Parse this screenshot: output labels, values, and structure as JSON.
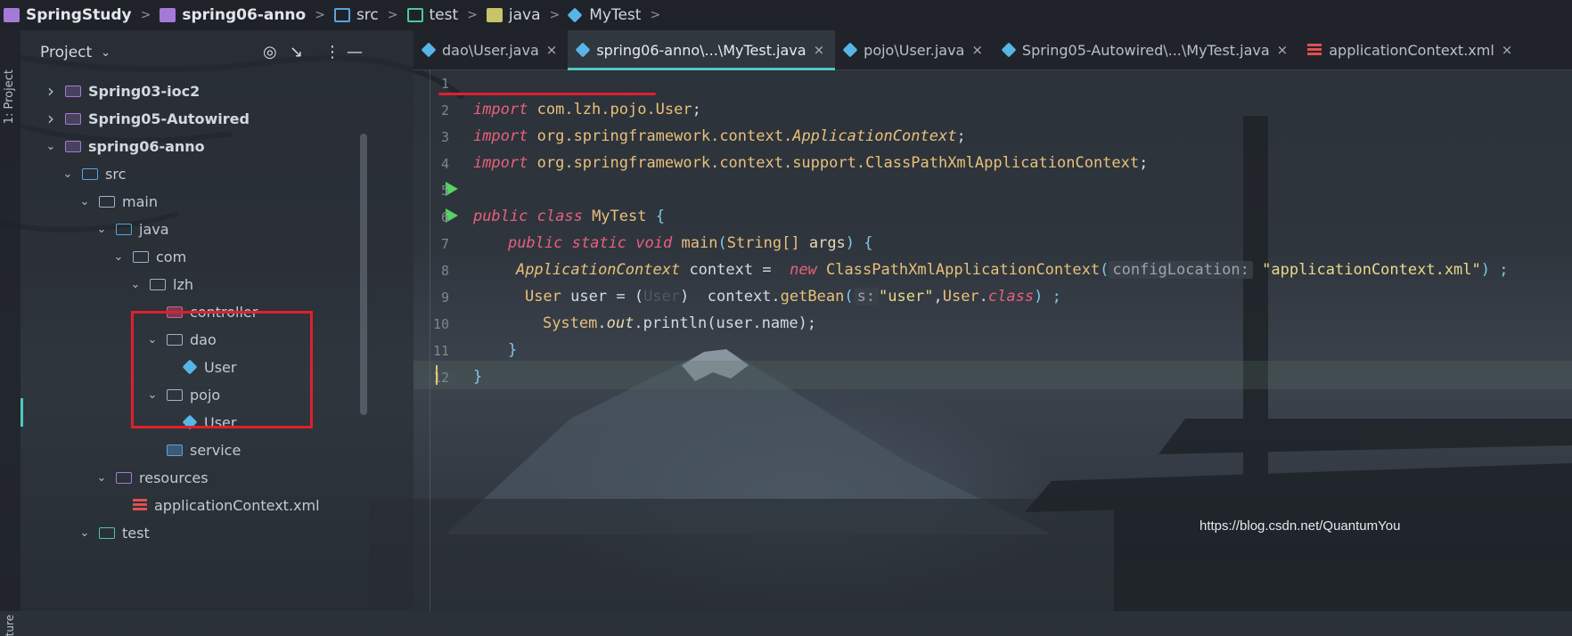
{
  "breadcrumb": [
    {
      "label": "SpringStudy",
      "icon": "project-icon",
      "bold": true
    },
    {
      "label": "spring06-anno",
      "icon": "module-icon",
      "bold": true
    },
    {
      "label": "src",
      "icon": "src-folder-icon",
      "bold": false
    },
    {
      "label": "test",
      "icon": "test-folder-icon",
      "bold": false
    },
    {
      "label": "java",
      "icon": "folder-icon",
      "bold": false
    },
    {
      "label": "MyTest",
      "icon": "class-icon",
      "bold": false
    }
  ],
  "left_strip": {
    "project_label": "1: Project",
    "structure_label": "ture"
  },
  "panel": {
    "title": "Project"
  },
  "tree": {
    "items": [
      {
        "label": "Spring03-ioc2",
        "depth": 0,
        "chev": ">",
        "kind": "mod",
        "bold": true
      },
      {
        "label": "Spring05-Autowired",
        "depth": 0,
        "chev": ">",
        "kind": "mod",
        "bold": true
      },
      {
        "label": "spring06-anno",
        "depth": 0,
        "chev": "v",
        "kind": "mod",
        "bold": true
      },
      {
        "label": "src",
        "depth": 1,
        "chev": "v",
        "kind": "src",
        "bold": false
      },
      {
        "label": "main",
        "depth": 2,
        "chev": "v",
        "kind": "folder",
        "bold": false
      },
      {
        "label": "java",
        "depth": 3,
        "chev": "v",
        "kind": "src",
        "bold": false
      },
      {
        "label": "com",
        "depth": 4,
        "chev": "v",
        "kind": "folder",
        "bold": false
      },
      {
        "label": "lzh",
        "depth": 5,
        "chev": "v",
        "kind": "folder",
        "bold": false
      },
      {
        "label": "controller",
        "depth": 6,
        "chev": "",
        "kind": "ctl",
        "bold": false
      },
      {
        "label": "dao",
        "depth": 6,
        "chev": "v",
        "kind": "folder",
        "bold": false
      },
      {
        "label": "User",
        "depth": 7,
        "chev": "",
        "kind": "class",
        "bold": false
      },
      {
        "label": "pojo",
        "depth": 6,
        "chev": "v",
        "kind": "folder",
        "bold": false
      },
      {
        "label": "User",
        "depth": 7,
        "chev": "",
        "kind": "class",
        "bold": false
      },
      {
        "label": "service",
        "depth": 6,
        "chev": "",
        "kind": "svc",
        "bold": false
      },
      {
        "label": "resources",
        "depth": 3,
        "chev": "v",
        "kind": "res",
        "bold": false
      },
      {
        "label": "applicationContext.xml",
        "depth": 4,
        "chev": "",
        "kind": "xml",
        "bold": false
      },
      {
        "label": "test",
        "depth": 2,
        "chev": "v",
        "kind": "test",
        "bold": false
      }
    ]
  },
  "tabs": [
    {
      "label": "dao\\User.java",
      "icon": "class-icon",
      "active": false
    },
    {
      "label": "spring06-anno\\...\\MyTest.java",
      "icon": "class-icon",
      "active": true
    },
    {
      "label": "pojo\\User.java",
      "icon": "class-icon",
      "active": false
    },
    {
      "label": "Spring05-Autowired\\...\\MyTest.java",
      "icon": "class-icon",
      "active": false
    },
    {
      "label": "applicationContext.xml",
      "icon": "xml-icon",
      "active": false
    }
  ],
  "tab_close": "×",
  "line_numbers": [
    "1",
    "2",
    "3",
    "4",
    "5",
    "6",
    "7",
    "8",
    "9",
    "10",
    "11",
    "12"
  ],
  "code": {
    "l1": {
      "kw": "import",
      "pkg": "com.lzh.pojo.User",
      "end": ";"
    },
    "l2": {
      "kw": "import",
      "pkg": "org.springframework.context.",
      "cls": "ApplicationContext",
      "end": ";"
    },
    "l3": {
      "kw": "import",
      "pkg": "org.springframework.context.support.ClassPathXmlApplicationContext",
      "end": ";"
    },
    "l5": {
      "kw1": "public",
      "kw2": "class",
      "name": "MyTest",
      "brace": "{"
    },
    "l6": {
      "kw1": "public",
      "kw2": "static",
      "kw3": "void",
      "fn": "main",
      "p1": "(",
      "type": "String[]",
      "arg": "args",
      "p2": ")",
      "brace": "{"
    },
    "l7": {
      "type": "ApplicationContext",
      "var": "context",
      "eq": "=",
      "kw": "new",
      "cls": "ClassPathXmlApplicationContext",
      "p1": "(",
      "hint": "configLocation:",
      "str": "\"applicationContext.xml\"",
      "end": ") ;"
    },
    "l8": {
      "type": "User",
      "var": "user",
      "eq": "= (",
      "cast": "User",
      "p2": ")",
      "obj": "context.",
      "fn": "getBean",
      "p1": "(",
      "hint": "s:",
      "str": "\"user\"",
      "comma": ",",
      "cls": "User",
      "dot": ".",
      "kw": "class",
      "end": ") ;"
    },
    "l9": {
      "cls": "System",
      "dot": ".",
      "field": "out",
      "call": ".println(user.name);"
    },
    "l10": {
      "brace": "}"
    },
    "l11": {
      "brace": "}"
    }
  },
  "watermark": "https://blog.csdn.net/QuantumYou",
  "colors": {
    "accent": "#4ec9c0",
    "highlight_box": "#e0202a",
    "run_icon": "#56d364"
  }
}
